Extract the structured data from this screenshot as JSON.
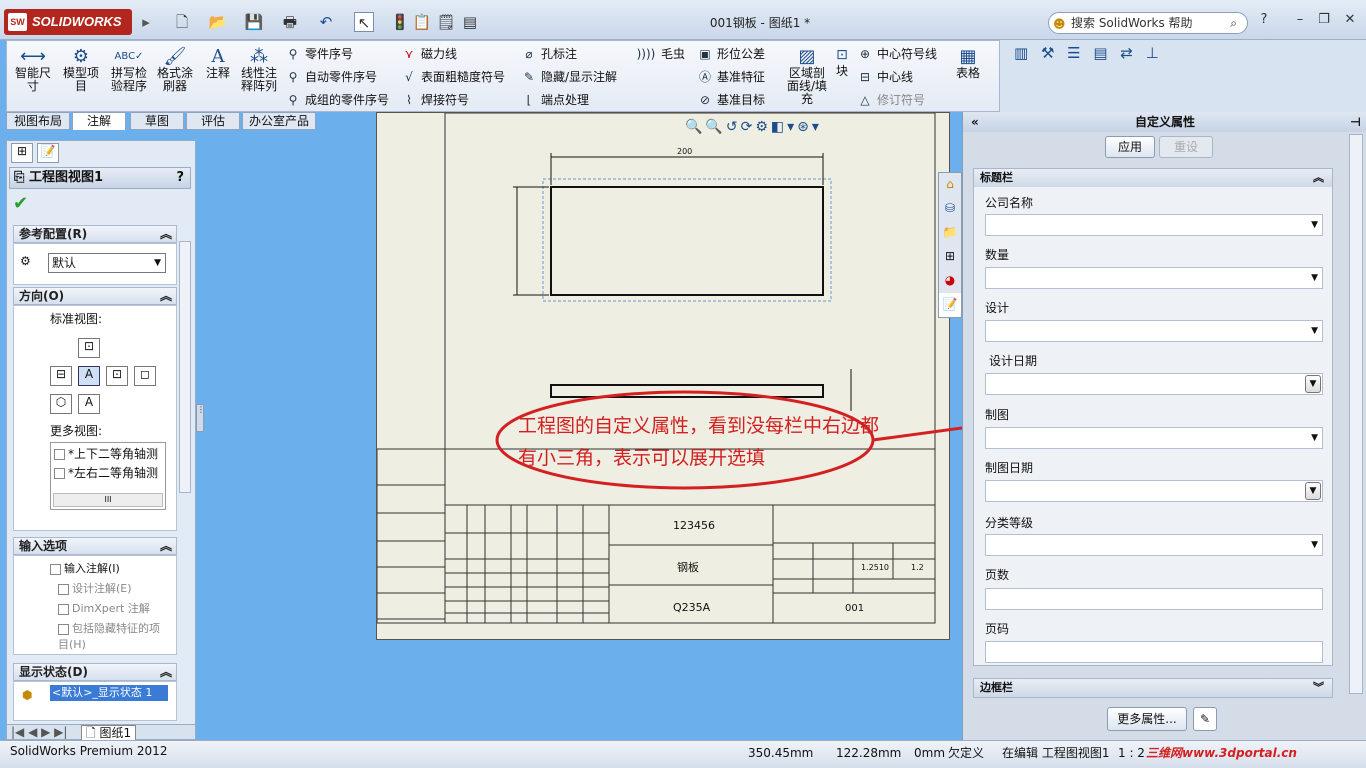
{
  "app": {
    "logo_text": "SOLIDWORKS",
    "document_title": "001钢板 - 图纸1 *",
    "search_placeholder": "搜索 SolidWorks 帮助",
    "help_label": "?"
  },
  "ribbon": {
    "big_buttons": [
      {
        "label": "智能尺寸",
        "icon": "smart-dimension-icon"
      },
      {
        "label": "模型项目",
        "icon": "model-items-icon"
      },
      {
        "label": "拼写检验程序",
        "icon": "spell-check-icon"
      },
      {
        "label": "格式涂刷器",
        "icon": "format-painter-icon"
      },
      {
        "label": "注释",
        "icon": "note-icon"
      },
      {
        "label": "线性注释阵列",
        "icon": "linear-note-pattern-icon"
      }
    ],
    "col1": [
      "零件序号",
      "自动零件序号",
      "成组的零件序号"
    ],
    "col2": [
      "磁力线",
      "表面粗糙度符号",
      "焊接符号"
    ],
    "col3": [
      "孔标注",
      "隐藏/显示注解",
      "端点处理"
    ],
    "col4": [
      "毛虫"
    ],
    "col5": [
      "形位公差",
      "基准特征",
      "基准目标"
    ],
    "big2": [
      {
        "label": "区域剖面线/填充",
        "icon": "area-hatch-icon"
      },
      {
        "label": "块",
        "icon": "block-icon"
      }
    ],
    "col6": [
      "中心符号线",
      "中心线",
      "修订符号"
    ],
    "table_label": "表格"
  },
  "tabs": [
    "视图布局",
    "注解",
    "草图",
    "评估",
    "办公室产品"
  ],
  "active_tab": 1,
  "left_panel": {
    "title": "工程图视图1",
    "help": "?",
    "ref_config": {
      "header": "参考配置(R)",
      "value": "默认"
    },
    "orientation": {
      "header": "方向(O)",
      "standard_views": "标准视图:",
      "more_views": "更多视图:",
      "more_items": [
        "*上下二等角轴测",
        "*左右二等角轴测"
      ],
      "scroll_label": "III"
    },
    "import_options": {
      "header": "输入选项",
      "items": [
        "输入注解(I)",
        "设计注解(E)",
        "DimXpert 注解",
        "包括隐藏特征的项目(H)"
      ]
    },
    "display_state": {
      "header": "显示状态(D)",
      "value": "<默认>_显示状态 1"
    }
  },
  "sheet_tab": "图纸1",
  "drawing": {
    "dim_top": "200",
    "title_block": {
      "part_no": "123456",
      "material_name": "钢板",
      "material": "Q235A",
      "drawing_no": "001",
      "scale": "1.2510",
      "scale2": "1.2"
    },
    "annotation": "工程图的自定义属性，看到没每栏中右边都有小三角，表示可以展开选填"
  },
  "right_panel": {
    "title": "自定义属性",
    "apply": "应用",
    "reset": "重设",
    "section_titlebar": "标题栏",
    "fields": [
      {
        "label": "公司名称",
        "type": "dropdown"
      },
      {
        "label": "数量",
        "type": "dropdown"
      },
      {
        "label": "设计",
        "type": "dropdown"
      },
      {
        "label": "设计日期",
        "type": "date"
      },
      {
        "label": "制图",
        "type": "dropdown"
      },
      {
        "label": "制图日期",
        "type": "date"
      },
      {
        "label": "分类等级",
        "type": "dropdown"
      },
      {
        "label": "页数",
        "type": "text"
      },
      {
        "label": "页码",
        "type": "text"
      }
    ],
    "section_border": "边框栏",
    "more_props": "更多属性..."
  },
  "status": {
    "product": "SolidWorks Premium 2012",
    "x": "350.45mm",
    "y": "122.28mm",
    "z": "0mm",
    "state": "欠定义",
    "editing": "在编辑 工程图视图1",
    "scale": "1 : 2",
    "watermark": "三维网www.3dportal.cn"
  },
  "colors": {
    "annotation_red": "#d42020",
    "sheet_bg": "#eeeee2",
    "graphics_bg": "#6bb0ec"
  }
}
